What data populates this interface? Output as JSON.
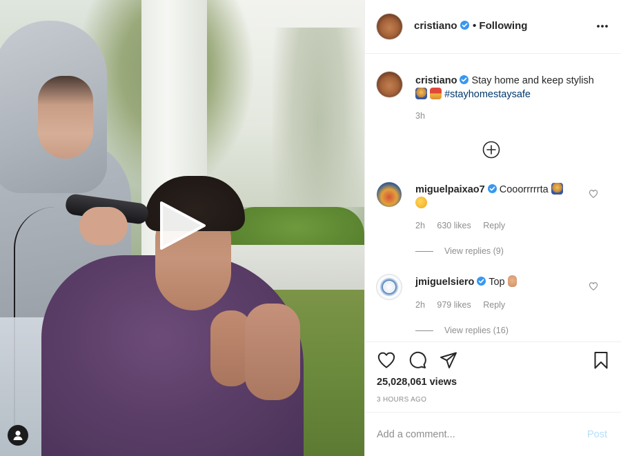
{
  "post": {
    "author": "cristiano",
    "follow_state": "• Following",
    "caption_text": "Stay home and keep stylish",
    "caption_emojis": [
      "person-getting-haircut-emoji",
      "barber-emoji"
    ],
    "hashtag": "#stayhomestaysafe",
    "caption_time": "3h",
    "views": "25,028,061 views",
    "time_ago": "3 HOURS AGO"
  },
  "comments": [
    {
      "username": "miguelpaixao7",
      "text": "Cooorrrrrta",
      "emojis": [
        "person-getting-haircut-emoji",
        "rofl-emoji"
      ],
      "time": "2h",
      "likes": "630 likes",
      "reply_label": "Reply",
      "view_replies": "View replies (9)"
    },
    {
      "username": "jmiguelsiero",
      "text": "Top",
      "emojis": [
        "ok-hand-emoji"
      ],
      "time": "2h",
      "likes": "979 likes",
      "reply_label": "Reply",
      "view_replies": "View replies (16)"
    }
  ],
  "comment_box": {
    "placeholder": "Add a comment...",
    "post_label": "Post"
  },
  "colors": {
    "verified": "#3897f0",
    "text": "#262626",
    "muted": "#8e8e8e",
    "hashtag": "#00376b",
    "post_disabled": "#b2dffc"
  }
}
